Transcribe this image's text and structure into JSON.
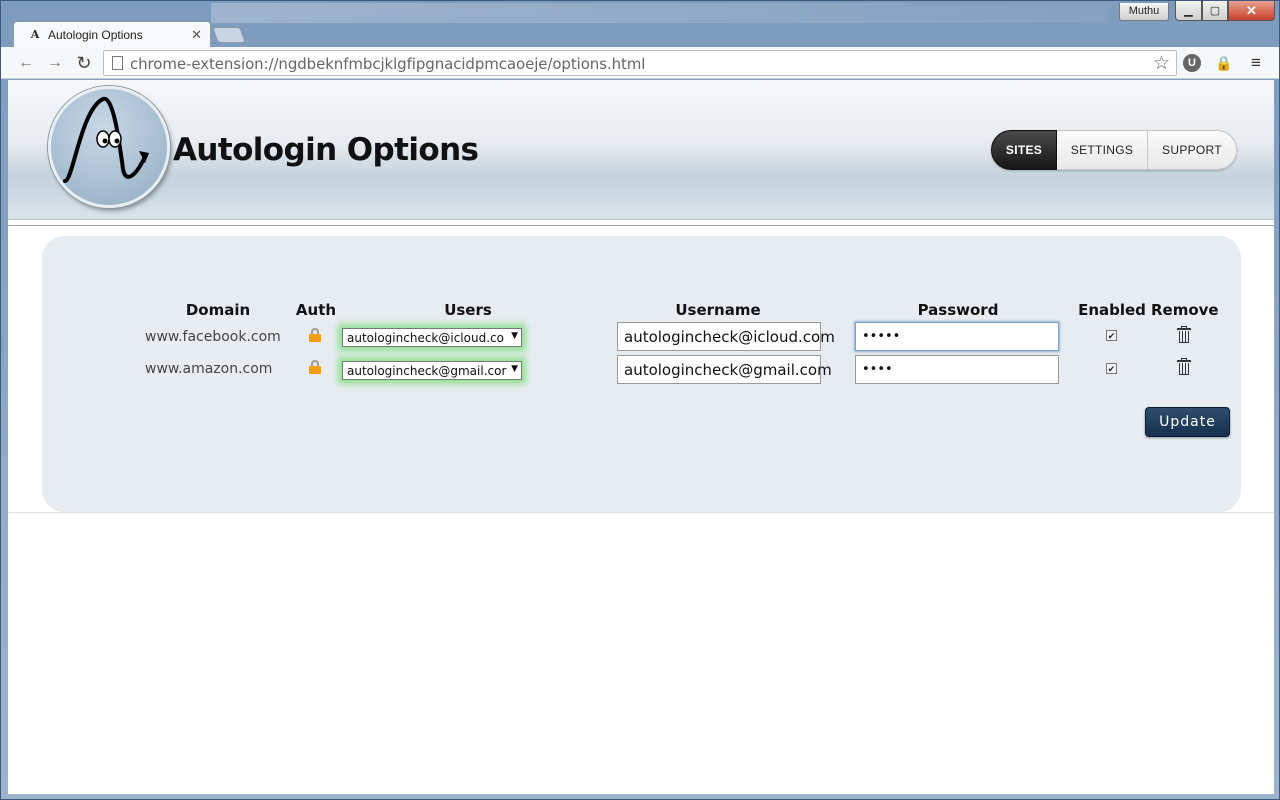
{
  "browser": {
    "profile_name": "Muthu",
    "tab_title": "Autologin Options",
    "favicon": "A",
    "url": "chrome-extension://ngdbeknfmbcjklgfipgnacidpmcaoeje/options.html",
    "extension_badge": "U",
    "icons": [
      "back-arrow-icon",
      "forward-arrow-icon",
      "reload-icon",
      "bookmark-star-icon",
      "lock-extension-icon",
      "menu-icon"
    ]
  },
  "header": {
    "title": "Autologin Options",
    "nav": [
      "SITES",
      "SETTINGS",
      "SUPPORT"
    ],
    "active_nav": "SITES"
  },
  "table": {
    "columns": {
      "domain": "Domain",
      "auth": "Auth",
      "users": "Users",
      "username": "Username",
      "password": "Password",
      "enabled": "Enabled",
      "remove": "Remove"
    },
    "rows": [
      {
        "domain": "www.facebook.com",
        "user_selected": "autologincheck@icloud.co",
        "username": "autologincheck@icloud.com",
        "password_mask": "•••••",
        "enabled": true
      },
      {
        "domain": "www.amazon.com",
        "user_selected": "autologincheck@gmail.cor",
        "username": "autologincheck@gmail.com",
        "password_mask": "••••",
        "enabled": true
      }
    ],
    "update_label": "Update"
  },
  "colors": {
    "lock": "#f39c12",
    "update_button": "#1e3a5a",
    "select_glow": "#78dc78"
  }
}
